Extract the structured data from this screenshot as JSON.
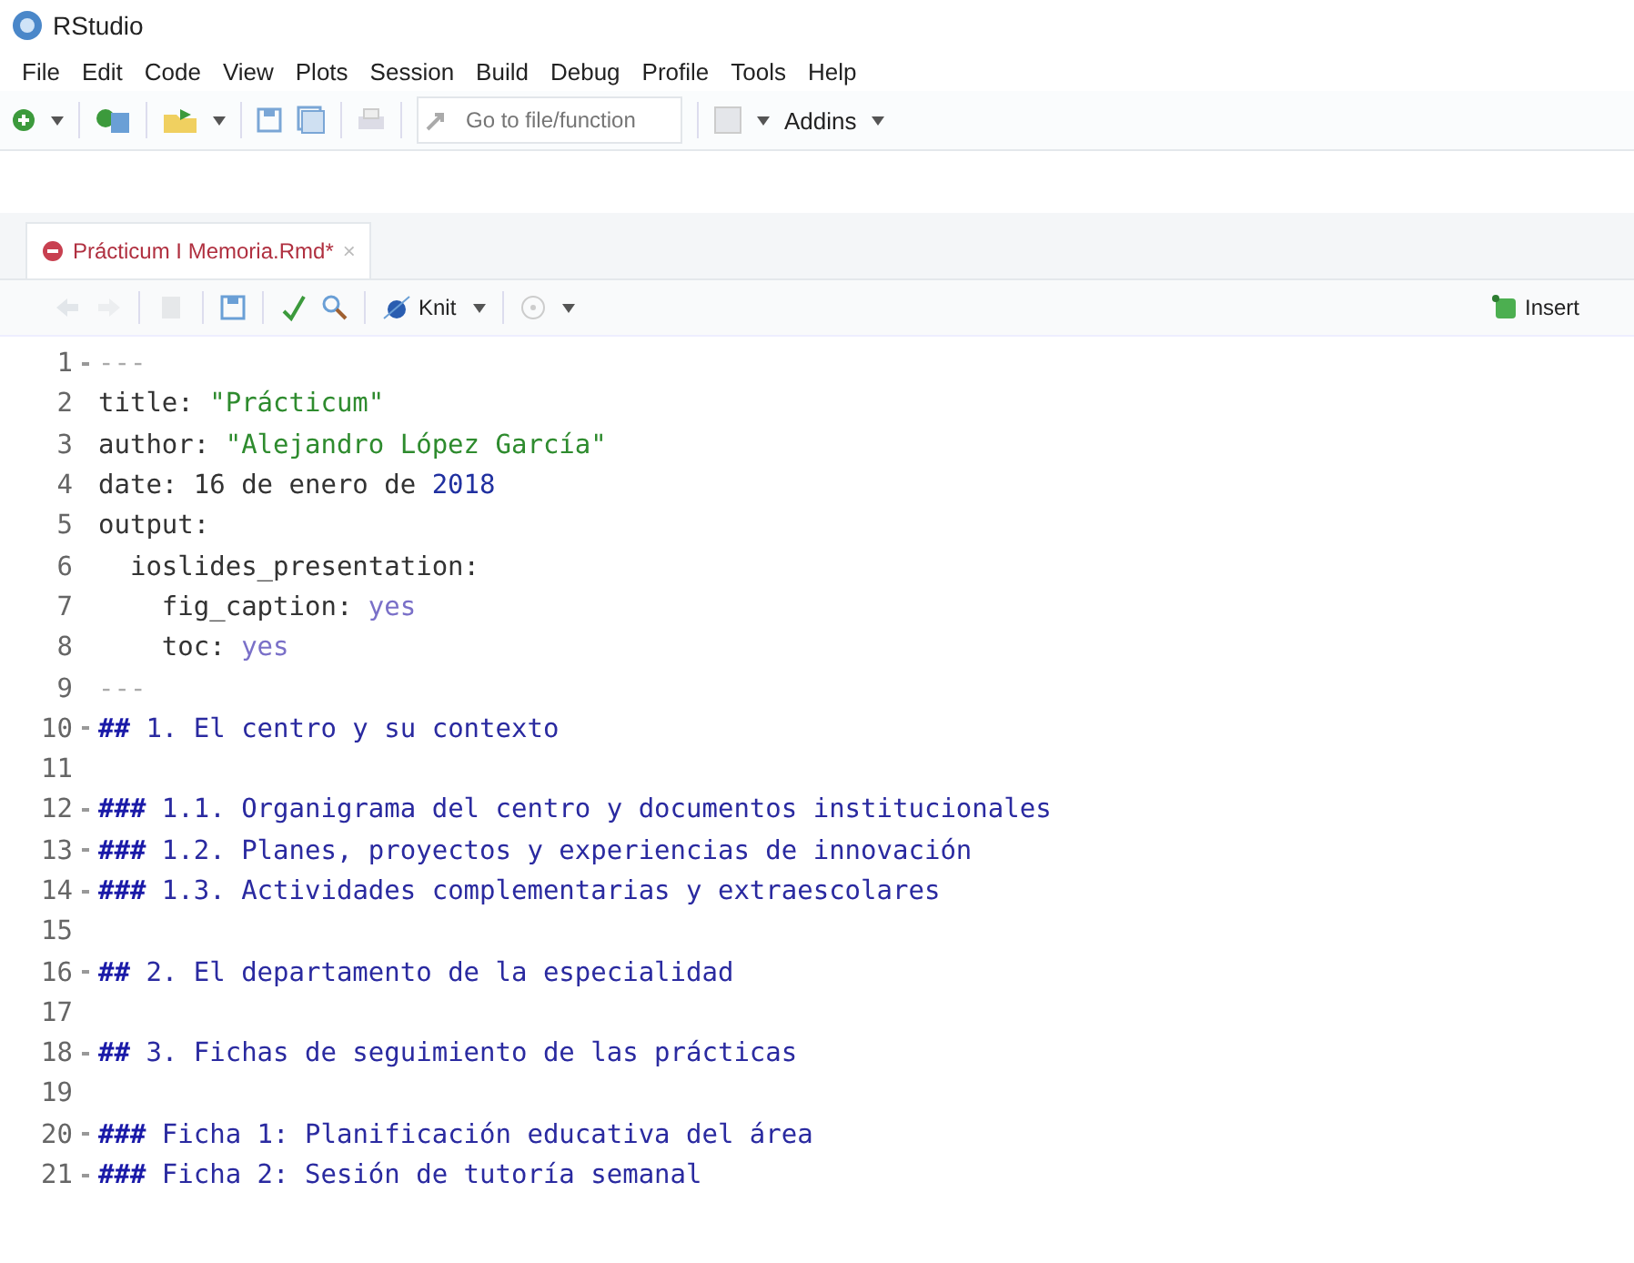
{
  "window": {
    "title": "RStudio"
  },
  "menu": [
    "File",
    "Edit",
    "Code",
    "View",
    "Plots",
    "Session",
    "Build",
    "Debug",
    "Profile",
    "Tools",
    "Help"
  ],
  "toolbar": {
    "search": {
      "placeholder": "Go to file/function"
    },
    "addins": "Addins"
  },
  "tabs": [
    {
      "label": "Prácticum I Memoria.Rmd*",
      "selected": true,
      "close": "×"
    }
  ],
  "editor_toolbar": {
    "knit": "Knit",
    "insert": "Insert"
  },
  "code_lines": [
    {
      "number": "1",
      "foldable": true,
      "segments": [
        {
          "kind": "dashes",
          "text": "---"
        }
      ]
    },
    {
      "number": "2",
      "foldable": false,
      "segments": [
        {
          "kind": "key",
          "text": "title: "
        },
        {
          "kind": "string",
          "text": "\"Prácticum\""
        }
      ]
    },
    {
      "number": "3",
      "foldable": false,
      "segments": [
        {
          "kind": "key",
          "text": "author: "
        },
        {
          "kind": "string",
          "text": "\"Alejandro López García\""
        }
      ]
    },
    {
      "number": "4",
      "foldable": false,
      "segments": [
        {
          "kind": "key",
          "text": "date: 16 de enero de "
        },
        {
          "kind": "number",
          "text": "2018"
        }
      ]
    },
    {
      "number": "5",
      "foldable": false,
      "segments": [
        {
          "kind": "key",
          "text": "output:"
        }
      ]
    },
    {
      "number": "6",
      "foldable": false,
      "segments": [
        {
          "kind": "key",
          "text": "  ioslides_presentation:"
        }
      ]
    },
    {
      "number": "7",
      "foldable": false,
      "segments": [
        {
          "kind": "key",
          "text": "    fig_caption: "
        },
        {
          "kind": "value",
          "text": "yes"
        }
      ]
    },
    {
      "number": "8",
      "foldable": false,
      "segments": [
        {
          "kind": "key",
          "text": "    toc: "
        },
        {
          "kind": "value",
          "text": "yes"
        }
      ]
    },
    {
      "number": "9",
      "foldable": false,
      "segments": [
        {
          "kind": "dashes",
          "text": "---"
        }
      ]
    },
    {
      "number": "10",
      "foldable": true,
      "segments": [
        {
          "kind": "marker",
          "text": "##"
        },
        {
          "kind": "header",
          "text": " 1. El centro y su contexto"
        }
      ]
    },
    {
      "number": "11",
      "foldable": false
    },
    {
      "number": "12",
      "foldable": true,
      "segments": [
        {
          "kind": "marker",
          "text": "###"
        },
        {
          "kind": "header",
          "text": " 1.1. Organigrama del centro y documentos institucionales"
        }
      ]
    },
    {
      "number": "13",
      "foldable": true,
      "segments": [
        {
          "kind": "marker",
          "text": "###"
        },
        {
          "kind": "header",
          "text": " 1.2. Planes, proyectos y experiencias de innovación"
        }
      ]
    },
    {
      "number": "14",
      "foldable": true,
      "segments": [
        {
          "kind": "marker",
          "text": "###"
        },
        {
          "kind": "header",
          "text": " 1.3. Actividades complementarias y extraescolares"
        }
      ]
    },
    {
      "number": "15",
      "foldable": false
    },
    {
      "number": "16",
      "foldable": true,
      "segments": [
        {
          "kind": "marker",
          "text": "##"
        },
        {
          "kind": "header",
          "text": " 2. El departamento de la especialidad"
        }
      ]
    },
    {
      "number": "17",
      "foldable": false
    },
    {
      "number": "18",
      "foldable": true,
      "segments": [
        {
          "kind": "marker",
          "text": "##"
        },
        {
          "kind": "header",
          "text": " 3. Fichas de seguimiento de las prácticas"
        }
      ]
    },
    {
      "number": "19",
      "foldable": false
    },
    {
      "number": "20",
      "foldable": true,
      "segments": [
        {
          "kind": "marker",
          "text": "###"
        },
        {
          "kind": "header",
          "text": " Ficha 1: Planificación educativa del área"
        }
      ]
    },
    {
      "number": "21",
      "foldable": true,
      "segments": [
        {
          "kind": "marker",
          "text": "###"
        },
        {
          "kind": "header",
          "text": " Ficha 2: Sesión de tutoría semanal"
        }
      ]
    }
  ]
}
